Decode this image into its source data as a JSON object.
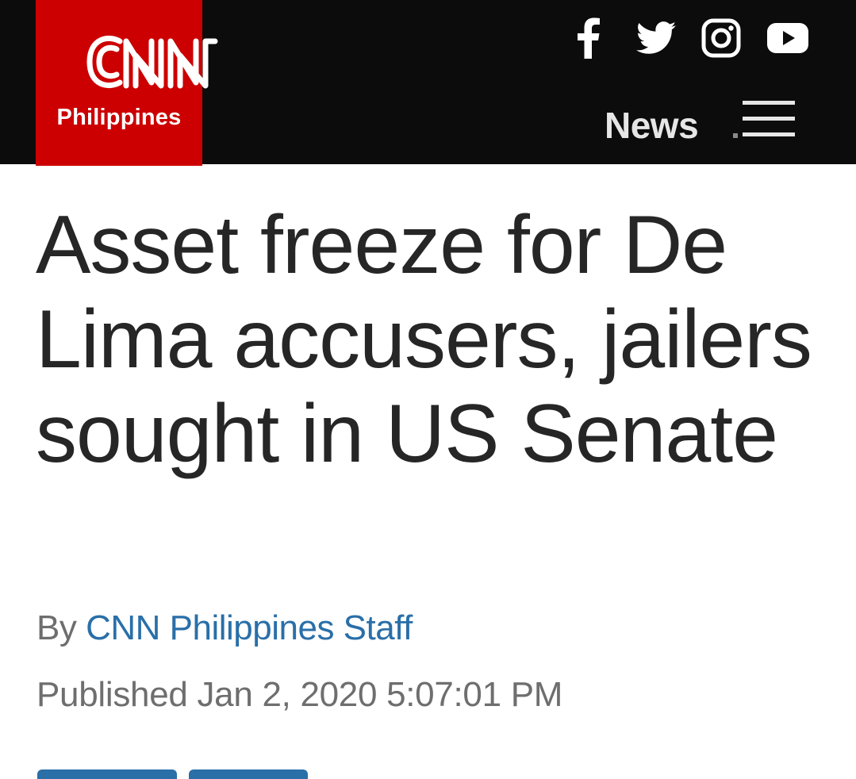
{
  "brand": {
    "logo_text": "CNN",
    "edition": "Philippines",
    "color": "#cc0000"
  },
  "social": [
    {
      "name": "facebook-icon"
    },
    {
      "name": "twitter-icon"
    },
    {
      "name": "instagram-icon"
    },
    {
      "name": "youtube-icon"
    }
  ],
  "nav": {
    "section_label": "News",
    "menu_icon": "hamburger-menu-icon"
  },
  "article": {
    "headline": "Asset freeze for De Lima accusers, jailers sought in US Senate",
    "byline_prefix": "By",
    "author": "CNN Philippines Staff",
    "published": "Published Jan 2, 2020 5:07:01 PM"
  },
  "colors": {
    "topbar": "#0c0c0c",
    "link": "#2a6fa8",
    "headline": "#262626",
    "meta": "#6e6e6e"
  }
}
